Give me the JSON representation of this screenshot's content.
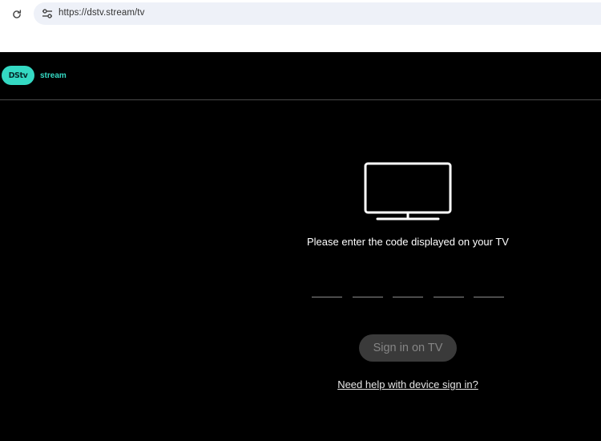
{
  "browser": {
    "url": "https://dstv.stream/tv",
    "reload_icon": "reload-icon",
    "site_info_icon": "tune-icon"
  },
  "header": {
    "logo_mark": "DStv",
    "logo_word": "stream",
    "brand_color": "#34d9c3"
  },
  "main": {
    "device_icon": "tv-icon",
    "prompt": "Please enter the code displayed on your TV",
    "code_length": 5,
    "code_values": [
      "",
      "",
      "",
      "",
      ""
    ],
    "signin_label": "Sign in on TV",
    "help_link": "Need help with device sign in?"
  }
}
